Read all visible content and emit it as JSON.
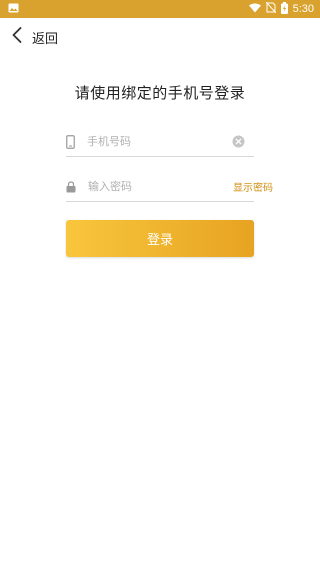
{
  "status_bar": {
    "time": "5:30",
    "colors": {
      "background": "#d9a22e"
    },
    "icons": [
      "image-icon",
      "wifi-icon",
      "no-sim-icon",
      "battery-icon"
    ]
  },
  "header": {
    "back_label": "返回"
  },
  "title": "请使用绑定的手机号登录",
  "phone_field": {
    "placeholder": "手机号码",
    "value": ""
  },
  "password_field": {
    "placeholder": "输入密码",
    "value": "",
    "show_password_label": "显示密码"
  },
  "login_button": {
    "label": "登录",
    "colors": {
      "start": "#f8c63c",
      "end": "#e7a322"
    }
  },
  "accent_color": "#d08f12"
}
